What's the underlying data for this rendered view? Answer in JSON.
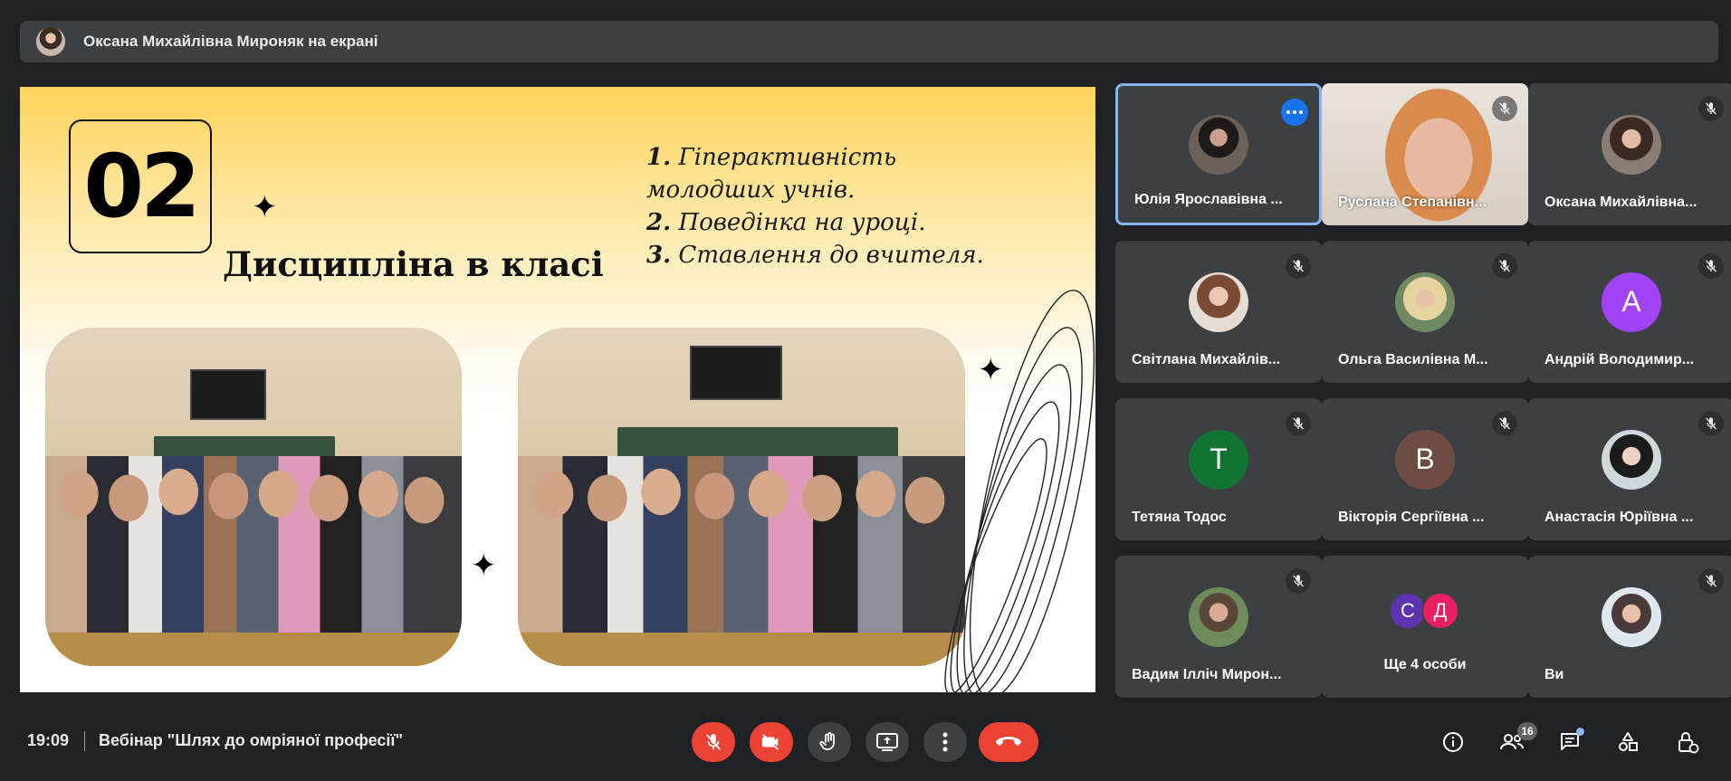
{
  "presenter_bar": {
    "text": "Оксана Михайлівна Мироняк на екрані"
  },
  "slide": {
    "number": "02",
    "title": "Дисципліна в класі",
    "points": [
      {
        "num": "1.",
        "text": "Гіперактивність молодших учнів."
      },
      {
        "num": "2.",
        "text": "Поведінка на уроці."
      },
      {
        "num": "3.",
        "text": "Ставлення до вчителя."
      }
    ]
  },
  "participants": [
    {
      "name": "Юлія Ярославівна ...",
      "active": true,
      "avatar": "photo"
    },
    {
      "name": "Руслана Степанівн...",
      "avatar": "video"
    },
    {
      "name": "Оксана Михайлівна...",
      "avatar": "photo"
    },
    {
      "name": "Світлана Михайлів...",
      "avatar": "photo"
    },
    {
      "name": "Ольга Василівна М...",
      "avatar": "photo"
    },
    {
      "name": "Андрій Володимир...",
      "initial": "A",
      "color": "#a142f4"
    },
    {
      "name": "Тетяна Тодос",
      "initial": "T",
      "color": "#137333"
    },
    {
      "name": "Вікторія Сергіївна ...",
      "initial": "B",
      "color": "#6d4c41"
    },
    {
      "name": "Анастасія Юріївна ...",
      "avatar": "photo"
    },
    {
      "name": "Вадим Ілліч Мирон...",
      "avatar": "photo"
    },
    {
      "more_label": "Ще 4 особи",
      "initials": [
        "С",
        "Д"
      ],
      "colors": [
        "#5e35b1",
        "#e91e63"
      ]
    },
    {
      "name": "Ви",
      "avatar": "photo"
    }
  ],
  "bottom": {
    "time": "19:09",
    "meeting_title": "Вебінар \"Шлях до омріяної професії\"",
    "participant_count": "16"
  },
  "colors": {
    "accent": "#8ab4f8",
    "danger": "#ea4335",
    "panel": "#3c4043",
    "background": "#202124"
  },
  "icons": [
    "mic-off-icon",
    "camera-off-icon",
    "hand-icon",
    "present-icon",
    "more-vert-icon",
    "hang-up-icon",
    "info-icon",
    "people-icon",
    "chat-icon",
    "activities-icon",
    "host-controls-icon"
  ]
}
